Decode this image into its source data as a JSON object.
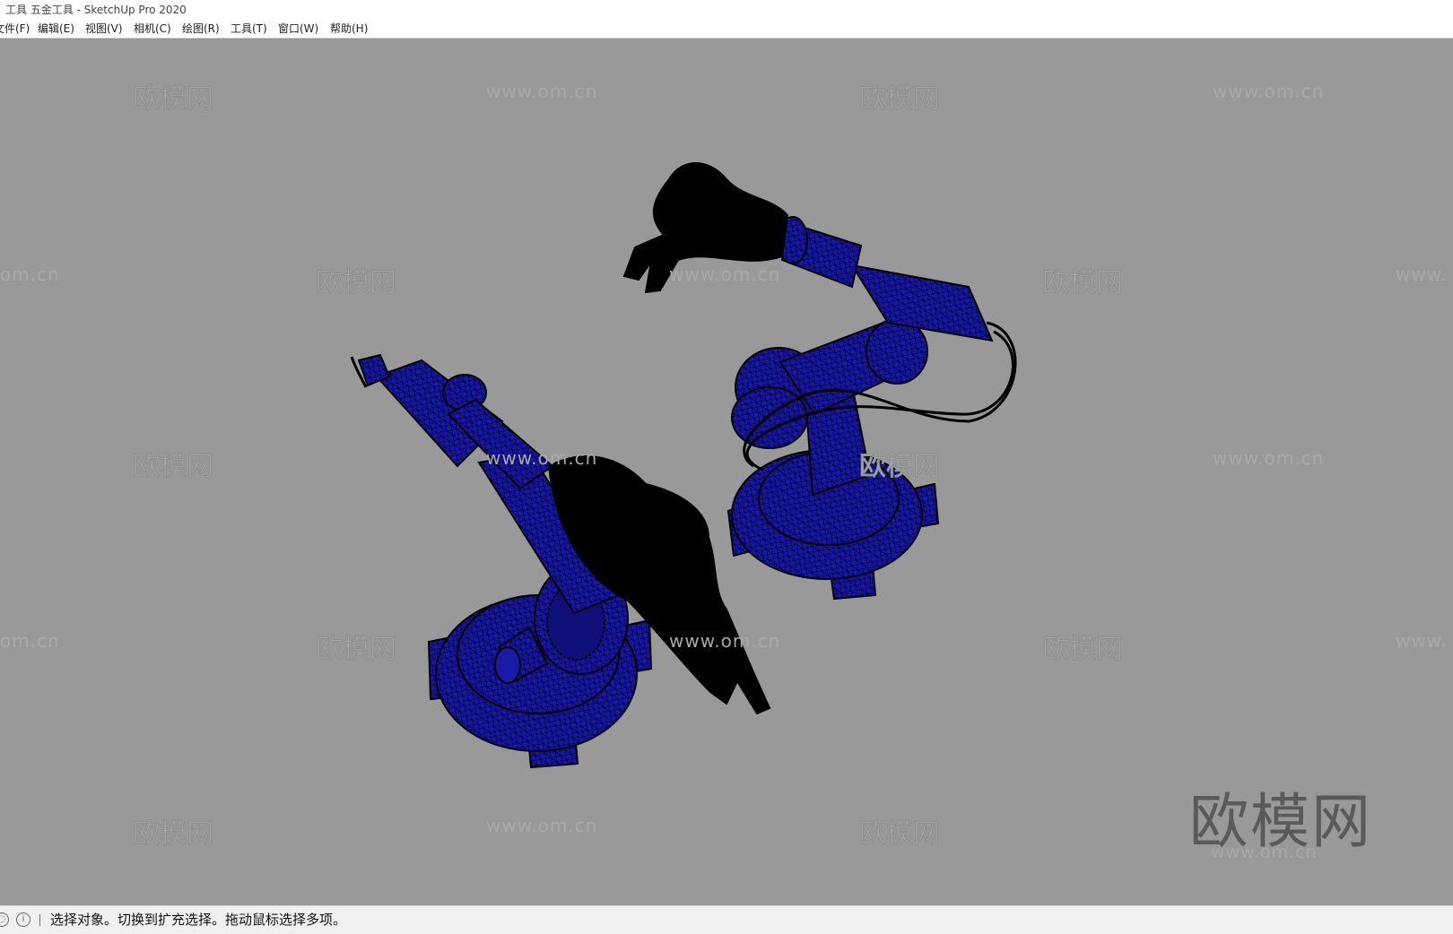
{
  "window": {
    "title": "工具 五金工具 - SketchUp Pro 2020"
  },
  "menubar": {
    "items": [
      {
        "id": "file",
        "label": "文件(F)"
      },
      {
        "id": "edit",
        "label": "编辑(E)"
      },
      {
        "id": "view",
        "label": "视图(V)"
      },
      {
        "id": "camera",
        "label": "相机(C)"
      },
      {
        "id": "draw",
        "label": "绘图(R)"
      },
      {
        "id": "tools",
        "label": "工具(T)"
      },
      {
        "id": "window",
        "label": "窗口(W)"
      },
      {
        "id": "help",
        "label": "帮助(H)"
      }
    ]
  },
  "watermark": {
    "logo_text": "欧模网",
    "url_text": "www.om.cn",
    "url_partial_left": "om.cn",
    "url_partial_right": "www.",
    "url_mid_partial": "www.om.cn"
  },
  "model": {
    "arm_color": "#1a1aa8",
    "dark_color": "#000000",
    "background_color": "#999999"
  },
  "statusbar": {
    "icon_a": "info-icon",
    "icon_b": "geo-icon",
    "text": "选择对象。切换到扩充选择。拖动鼠标选择多项。"
  }
}
